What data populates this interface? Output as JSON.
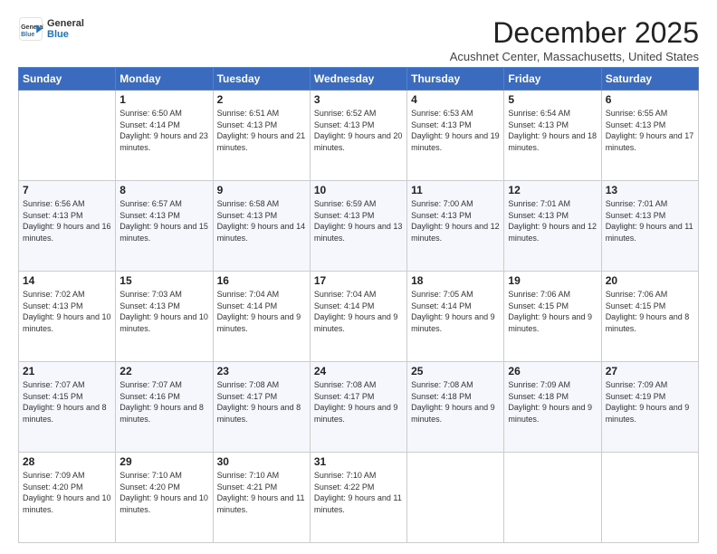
{
  "logo": {
    "line1": "General",
    "line2": "Blue",
    "icon": "▶"
  },
  "title": "December 2025",
  "subtitle": "Acushnet Center, Massachusetts, United States",
  "days": [
    "Sunday",
    "Monday",
    "Tuesday",
    "Wednesday",
    "Thursday",
    "Friday",
    "Saturday"
  ],
  "weeks": [
    [
      {
        "day": "",
        "sunrise": "",
        "sunset": "",
        "daylight": ""
      },
      {
        "day": "1",
        "sunrise": "Sunrise: 6:50 AM",
        "sunset": "Sunset: 4:14 PM",
        "daylight": "Daylight: 9 hours and 23 minutes."
      },
      {
        "day": "2",
        "sunrise": "Sunrise: 6:51 AM",
        "sunset": "Sunset: 4:13 PM",
        "daylight": "Daylight: 9 hours and 21 minutes."
      },
      {
        "day": "3",
        "sunrise": "Sunrise: 6:52 AM",
        "sunset": "Sunset: 4:13 PM",
        "daylight": "Daylight: 9 hours and 20 minutes."
      },
      {
        "day": "4",
        "sunrise": "Sunrise: 6:53 AM",
        "sunset": "Sunset: 4:13 PM",
        "daylight": "Daylight: 9 hours and 19 minutes."
      },
      {
        "day": "5",
        "sunrise": "Sunrise: 6:54 AM",
        "sunset": "Sunset: 4:13 PM",
        "daylight": "Daylight: 9 hours and 18 minutes."
      },
      {
        "day": "6",
        "sunrise": "Sunrise: 6:55 AM",
        "sunset": "Sunset: 4:13 PM",
        "daylight": "Daylight: 9 hours and 17 minutes."
      }
    ],
    [
      {
        "day": "7",
        "sunrise": "Sunrise: 6:56 AM",
        "sunset": "Sunset: 4:13 PM",
        "daylight": "Daylight: 9 hours and 16 minutes."
      },
      {
        "day": "8",
        "sunrise": "Sunrise: 6:57 AM",
        "sunset": "Sunset: 4:13 PM",
        "daylight": "Daylight: 9 hours and 15 minutes."
      },
      {
        "day": "9",
        "sunrise": "Sunrise: 6:58 AM",
        "sunset": "Sunset: 4:13 PM",
        "daylight": "Daylight: 9 hours and 14 minutes."
      },
      {
        "day": "10",
        "sunrise": "Sunrise: 6:59 AM",
        "sunset": "Sunset: 4:13 PM",
        "daylight": "Daylight: 9 hours and 13 minutes."
      },
      {
        "day": "11",
        "sunrise": "Sunrise: 7:00 AM",
        "sunset": "Sunset: 4:13 PM",
        "daylight": "Daylight: 9 hours and 12 minutes."
      },
      {
        "day": "12",
        "sunrise": "Sunrise: 7:01 AM",
        "sunset": "Sunset: 4:13 PM",
        "daylight": "Daylight: 9 hours and 12 minutes."
      },
      {
        "day": "13",
        "sunrise": "Sunrise: 7:01 AM",
        "sunset": "Sunset: 4:13 PM",
        "daylight": "Daylight: 9 hours and 11 minutes."
      }
    ],
    [
      {
        "day": "14",
        "sunrise": "Sunrise: 7:02 AM",
        "sunset": "Sunset: 4:13 PM",
        "daylight": "Daylight: 9 hours and 10 minutes."
      },
      {
        "day": "15",
        "sunrise": "Sunrise: 7:03 AM",
        "sunset": "Sunset: 4:13 PM",
        "daylight": "Daylight: 9 hours and 10 minutes."
      },
      {
        "day": "16",
        "sunrise": "Sunrise: 7:04 AM",
        "sunset": "Sunset: 4:14 PM",
        "daylight": "Daylight: 9 hours and 9 minutes."
      },
      {
        "day": "17",
        "sunrise": "Sunrise: 7:04 AM",
        "sunset": "Sunset: 4:14 PM",
        "daylight": "Daylight: 9 hours and 9 minutes."
      },
      {
        "day": "18",
        "sunrise": "Sunrise: 7:05 AM",
        "sunset": "Sunset: 4:14 PM",
        "daylight": "Daylight: 9 hours and 9 minutes."
      },
      {
        "day": "19",
        "sunrise": "Sunrise: 7:06 AM",
        "sunset": "Sunset: 4:15 PM",
        "daylight": "Daylight: 9 hours and 9 minutes."
      },
      {
        "day": "20",
        "sunrise": "Sunrise: 7:06 AM",
        "sunset": "Sunset: 4:15 PM",
        "daylight": "Daylight: 9 hours and 8 minutes."
      }
    ],
    [
      {
        "day": "21",
        "sunrise": "Sunrise: 7:07 AM",
        "sunset": "Sunset: 4:15 PM",
        "daylight": "Daylight: 9 hours and 8 minutes."
      },
      {
        "day": "22",
        "sunrise": "Sunrise: 7:07 AM",
        "sunset": "Sunset: 4:16 PM",
        "daylight": "Daylight: 9 hours and 8 minutes."
      },
      {
        "day": "23",
        "sunrise": "Sunrise: 7:08 AM",
        "sunset": "Sunset: 4:17 PM",
        "daylight": "Daylight: 9 hours and 8 minutes."
      },
      {
        "day": "24",
        "sunrise": "Sunrise: 7:08 AM",
        "sunset": "Sunset: 4:17 PM",
        "daylight": "Daylight: 9 hours and 9 minutes."
      },
      {
        "day": "25",
        "sunrise": "Sunrise: 7:08 AM",
        "sunset": "Sunset: 4:18 PM",
        "daylight": "Daylight: 9 hours and 9 minutes."
      },
      {
        "day": "26",
        "sunrise": "Sunrise: 7:09 AM",
        "sunset": "Sunset: 4:18 PM",
        "daylight": "Daylight: 9 hours and 9 minutes."
      },
      {
        "day": "27",
        "sunrise": "Sunrise: 7:09 AM",
        "sunset": "Sunset: 4:19 PM",
        "daylight": "Daylight: 9 hours and 9 minutes."
      }
    ],
    [
      {
        "day": "28",
        "sunrise": "Sunrise: 7:09 AM",
        "sunset": "Sunset: 4:20 PM",
        "daylight": "Daylight: 9 hours and 10 minutes."
      },
      {
        "day": "29",
        "sunrise": "Sunrise: 7:10 AM",
        "sunset": "Sunset: 4:20 PM",
        "daylight": "Daylight: 9 hours and 10 minutes."
      },
      {
        "day": "30",
        "sunrise": "Sunrise: 7:10 AM",
        "sunset": "Sunset: 4:21 PM",
        "daylight": "Daylight: 9 hours and 11 minutes."
      },
      {
        "day": "31",
        "sunrise": "Sunrise: 7:10 AM",
        "sunset": "Sunset: 4:22 PM",
        "daylight": "Daylight: 9 hours and 11 minutes."
      },
      {
        "day": "",
        "sunrise": "",
        "sunset": "",
        "daylight": ""
      },
      {
        "day": "",
        "sunrise": "",
        "sunset": "",
        "daylight": ""
      },
      {
        "day": "",
        "sunrise": "",
        "sunset": "",
        "daylight": ""
      }
    ]
  ]
}
